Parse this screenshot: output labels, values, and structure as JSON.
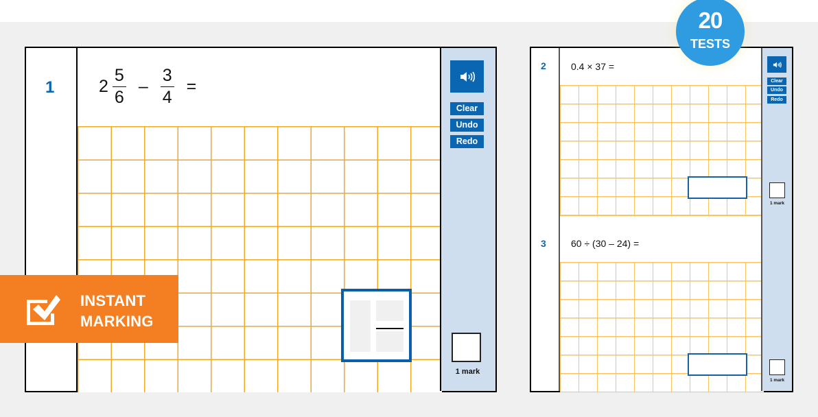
{
  "badge": {
    "count": "20",
    "label": "TESTS",
    "color": "#2f9be0"
  },
  "banner": {
    "line1": "INSTANT",
    "line2": "MARKING",
    "icon": "checkbox-tick-icon",
    "color": "#f47f22"
  },
  "colors": {
    "accent_blue": "#0a66b0",
    "side_panel": "#cfdeee",
    "grid_line": "#f5aa1e"
  },
  "questions": [
    {
      "number": "1",
      "expression": {
        "whole": "2",
        "frac1_num": "5",
        "frac1_den": "6",
        "operator": "–",
        "frac2_num": "3",
        "frac2_den": "4",
        "equals": "="
      },
      "answer_type": "fraction",
      "marks": "1 mark"
    },
    {
      "number": "2",
      "text": "0.4 × 37 =",
      "answer_type": "box",
      "marks": "1 mark"
    },
    {
      "number": "3",
      "text": "60 ÷ (30 – 24) =",
      "answer_type": "box",
      "marks": "1 mark"
    }
  ],
  "toolbar": {
    "audio_icon": "speaker-icon",
    "clear_label": "Clear",
    "undo_label": "Undo",
    "redo_label": "Redo"
  }
}
